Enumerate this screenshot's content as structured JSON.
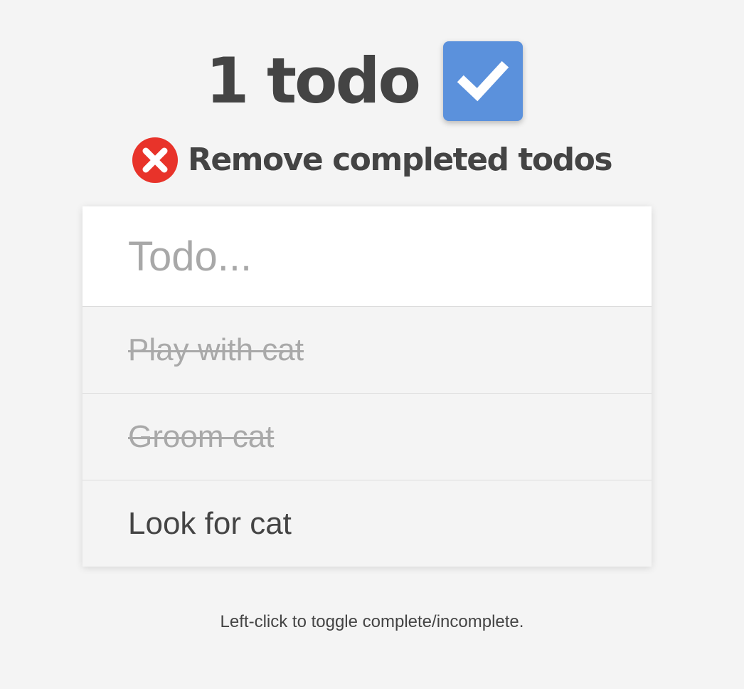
{
  "header": {
    "count_label": "1 todo",
    "toggle_icon": "check-icon",
    "toggle_color": "#5b91dc"
  },
  "actions": {
    "remove_completed_label": "Remove completed todos",
    "remove_icon": "close-circle-icon",
    "remove_icon_color": "#e8332a"
  },
  "new_todo": {
    "value": "",
    "placeholder": "Todo..."
  },
  "todos": [
    {
      "text": "Play with cat",
      "completed": true
    },
    {
      "text": "Groom cat",
      "completed": true
    },
    {
      "text": "Look for cat",
      "completed": false
    }
  ],
  "footer": {
    "hint": "Left-click to toggle complete/incomplete."
  }
}
